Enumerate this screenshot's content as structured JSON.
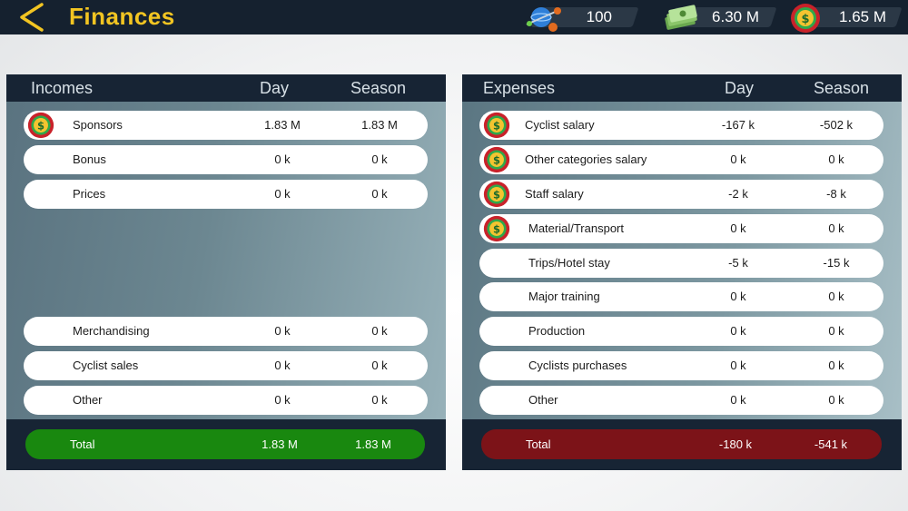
{
  "header": {
    "title": "Finances",
    "resources": [
      {
        "icon": "globe-icon",
        "value": "100"
      },
      {
        "icon": "money-stack-icon",
        "value": "6.30 M"
      },
      {
        "icon": "dollar-coin-icon",
        "value": "1.65 M"
      }
    ]
  },
  "incomes": {
    "headers": {
      "label": "Incomes",
      "day": "Day",
      "season": "Season"
    },
    "rows": [
      {
        "label": "Sponsors",
        "day": "1.83 M",
        "season": "1.83 M",
        "icon": "dollar-coin-icon"
      },
      {
        "label": "Bonus",
        "day": "0 k",
        "season": "0 k"
      },
      {
        "label": "Prices",
        "day": "0 k",
        "season": "0 k"
      },
      {
        "label": "Merchandising",
        "day": "0 k",
        "season": "0 k"
      },
      {
        "label": "Cyclist sales",
        "day": "0 k",
        "season": "0 k"
      },
      {
        "label": "Other",
        "day": "0 k",
        "season": "0 k"
      }
    ],
    "total": {
      "label": "Total",
      "day": "1.83 M",
      "season": "1.83 M",
      "color": "#19880f"
    }
  },
  "expenses": {
    "headers": {
      "label": "Expenses",
      "day": "Day",
      "season": "Season"
    },
    "rows": [
      {
        "label": "Cyclist salary",
        "day": "-167 k",
        "season": "-502 k",
        "icon": "dollar-coin-icon"
      },
      {
        "label": "Other categories salary",
        "day": "0 k",
        "season": "0 k",
        "icon": "dollar-coin-icon"
      },
      {
        "label": "Staff salary",
        "day": "-2 k",
        "season": "-8 k",
        "icon": "dollar-coin-icon"
      },
      {
        "label": "Material/Transport",
        "day": "0 k",
        "season": "0 k",
        "icon": "dollar-coin-icon"
      },
      {
        "label": "Trips/Hotel stay",
        "day": "-5 k",
        "season": "-15 k"
      },
      {
        "label": "Major training",
        "day": "0 k",
        "season": "0 k"
      },
      {
        "label": "Production",
        "day": "0 k",
        "season": "0 k"
      },
      {
        "label": "Cyclists purchases",
        "day": "0 k",
        "season": "0 k"
      },
      {
        "label": "Other",
        "day": "0 k",
        "season": "0 k"
      }
    ],
    "total": {
      "label": "Total",
      "day": "-180 k",
      "season": "-541 k",
      "color": "#7c1318"
    }
  }
}
